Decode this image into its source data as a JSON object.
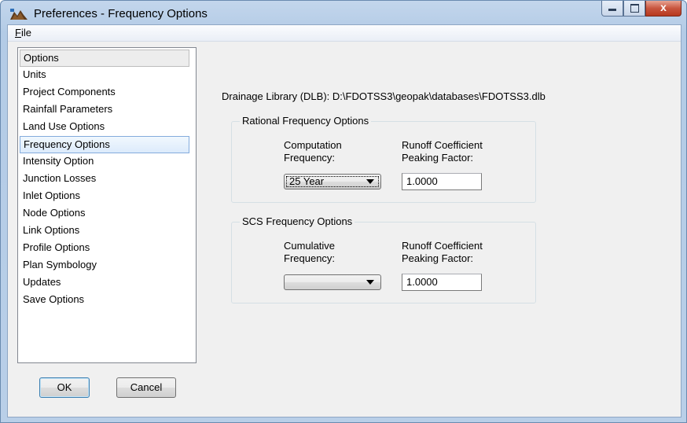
{
  "window": {
    "title": "Preferences - Frequency Options",
    "controls": {
      "minimize_icon": "minimize-icon",
      "maximize_icon": "maximize-icon",
      "close_icon": "close-icon",
      "close_glyph": "x"
    }
  },
  "menu": {
    "file_label": "File",
    "file_mnemonic": "F",
    "file_rest": "ile"
  },
  "sidebar": {
    "header": "Options",
    "items": [
      "Units",
      "Project Components",
      "Rainfall Parameters",
      "Land Use Options",
      "Frequency Options",
      "Intensity Option",
      "Junction Losses",
      "Inlet Options",
      "Node Options",
      "Link Options",
      "Profile Options",
      "Plan Symbology",
      "Updates",
      "Save Options"
    ],
    "selected": "Frequency Options"
  },
  "buttons": {
    "ok": "OK",
    "cancel": "Cancel"
  },
  "main": {
    "dlb_line": "Drainage Library (DLB): D:\\FDOTSS3\\geopak\\databases\\FDOTSS3.dlb",
    "rational": {
      "title": "Rational Frequency Options",
      "freq_label_1": "Computation",
      "freq_label_2": "Frequency:",
      "coef_label_1": "Runoff Coefficient",
      "coef_label_2": "Peaking Factor:",
      "frequency_value": "25 Year",
      "coefficient_value": "1.0000"
    },
    "scs": {
      "title": "SCS Frequency Options",
      "freq_label_1": "Cumulative",
      "freq_label_2": "Frequency:",
      "coef_label_1": "Runoff Coefficient",
      "coef_label_2": "Peaking Factor:",
      "frequency_value": "",
      "coefficient_value": "1.0000"
    }
  },
  "colors": {
    "title_gradient": "#c3d6ec",
    "close_button": "#c8553e",
    "selection_border": "#84acdd",
    "client_bg": "#f0f0f0"
  }
}
